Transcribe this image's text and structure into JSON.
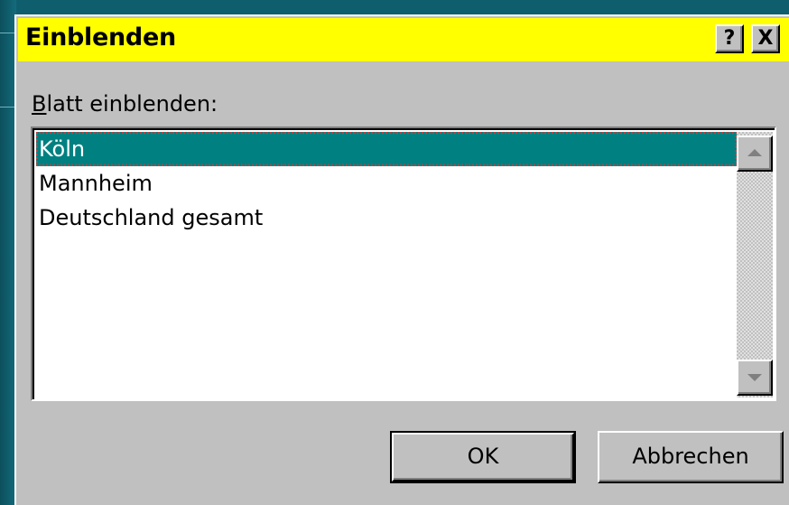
{
  "dialog": {
    "title": "Einblenden",
    "help_glyph": "?",
    "close_glyph": "X"
  },
  "sheet_list": {
    "label": "Blatt einblenden:",
    "items": [
      {
        "label": "Köln",
        "selected": true
      },
      {
        "label": "Mannheim",
        "selected": false
      },
      {
        "label": "Deutschland gesamt",
        "selected": false
      }
    ]
  },
  "buttons": {
    "ok_label": "OK",
    "cancel_label": "Abbrechen"
  },
  "colors": {
    "titlebar": "#ffff00",
    "selection": "#008080",
    "dialog_face": "#c0c0c0",
    "desktop": "#0f5e6e"
  },
  "icons": {
    "scroll_up": "arrow-up-icon",
    "scroll_down": "arrow-down-icon"
  }
}
